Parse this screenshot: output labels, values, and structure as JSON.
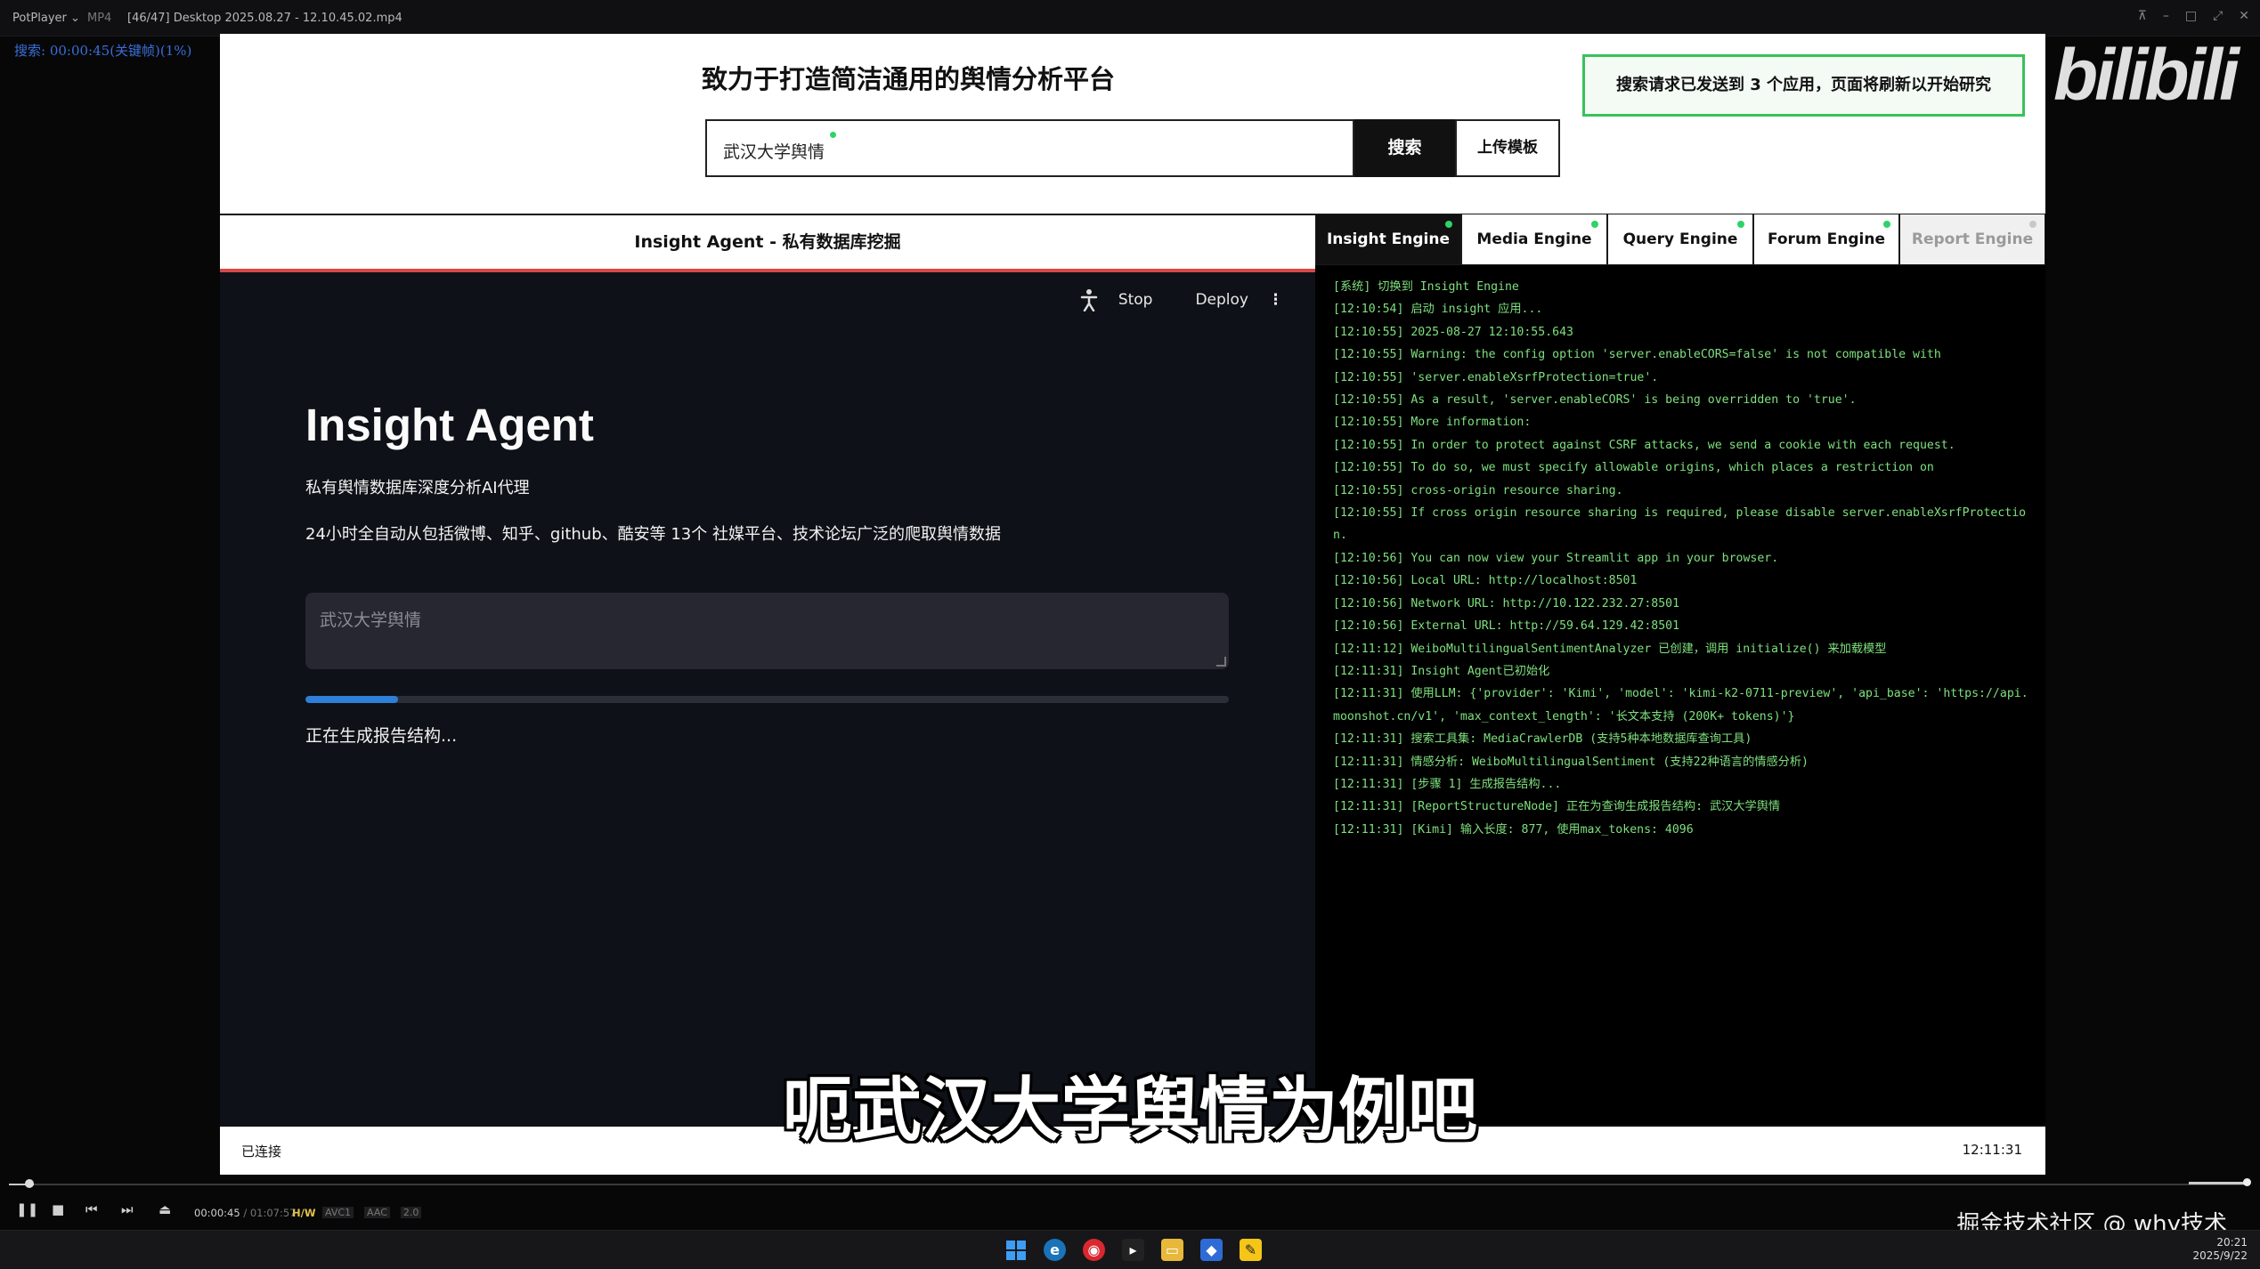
{
  "player": {
    "app_name": "PotPlayer ⌄",
    "format": "MP4",
    "file_title": "[46/47] Desktop 2025.08.27 - 12.10.45.02.mp4",
    "osd_text": "搜索: 00:00:45(关键帧)(1%)",
    "timecode": "00:00:45",
    "duration": "/ 01:07:57",
    "hw_label": "H/W",
    "codecs": [
      "AVC1",
      "AAC",
      "2.0"
    ],
    "progress": 0.011,
    "volume": 0.95
  },
  "app": {
    "title": "致力于打造简洁通用的舆情分析平台",
    "search_value": "武汉大学舆情",
    "search_button": "搜索",
    "upload_button": "上传模板",
    "toast": "搜索请求已发送到 3 个应用，页面将刷新以开始研究"
  },
  "left_panel": {
    "header": "Insight Agent - 私有数据库挖掘",
    "toolbar": {
      "stop": "Stop",
      "deploy": "Deploy"
    },
    "title": "Insight Agent",
    "subtitle": "私有舆情数据库深度分析AI代理",
    "description": "24小时全自动从包括微博、知乎、github、酷安等 13个 社媒平台、技术论坛广泛的爬取舆情数据",
    "textarea_placeholder": "武汉大学舆情",
    "progress": 0.1,
    "status": "正在生成报告结构..."
  },
  "tabs": [
    {
      "label": "Insight Engine",
      "state": "active"
    },
    {
      "label": "Media Engine",
      "state": "normal"
    },
    {
      "label": "Query Engine",
      "state": "normal"
    },
    {
      "label": "Forum Engine",
      "state": "normal"
    },
    {
      "label": "Report Engine",
      "state": "disabled"
    }
  ],
  "log_lines": [
    "[系统] 切换到 Insight Engine",
    "[12:10:54] 启动 insight 应用...",
    "[12:10:55] 2025-08-27 12:10:55.643",
    "[12:10:55] Warning: the config option 'server.enableCORS=false' is not compatible with",
    "[12:10:55] 'server.enableXsrfProtection=true'.",
    "[12:10:55] As a result, 'server.enableCORS' is being overridden to 'true'.",
    "[12:10:55] More information:",
    "[12:10:55] In order to protect against CSRF attacks, we send a cookie with each request.",
    "[12:10:55] To do so, we must specify allowable origins, which places a restriction on",
    "[12:10:55] cross-origin resource sharing.",
    "[12:10:55] If cross origin resource sharing is required, please disable server.enableXsrfProtection.",
    "[12:10:56] You can now view your Streamlit app in your browser.",
    "[12:10:56] Local URL: http://localhost:8501",
    "[12:10:56] Network URL: http://10.122.232.27:8501",
    "[12:10:56] External URL: http://59.64.129.42:8501",
    "[12:11:12] WeiboMultilingualSentimentAnalyzer 已创建，调用 initialize() 来加载模型",
    "[12:11:31] Insight Agent已初始化",
    "[12:11:31] 使用LLM: {'provider': 'Kimi', 'model': 'kimi-k2-0711-preview', 'api_base': 'https://api.moonshot.cn/v1', 'max_context_length': '长文本支持 (200K+ tokens)'}",
    "[12:11:31] 搜索工具集: MediaCrawlerDB (支持5种本地数据库查询工具)",
    "[12:11:31] 情感分析: WeiboMultilingualSentiment (支持22种语言的情感分析)",
    "[12:11:31] [步骤 1] 生成报告结构...",
    "[12:11:31] [ReportStructureNode] 正在为查询生成报告结构: 武汉大学舆情",
    "[12:11:31] [Kimi] 输入长度: 877, 使用max_tokens: 4096"
  ],
  "footer": {
    "status": "已连接",
    "time": "12:11:31"
  },
  "overlay": {
    "watermark": "bilibili",
    "subtitle": "呃武汉大学舆情为例吧",
    "credit": "掘金技术社区 @ why技术"
  },
  "tray": {
    "time": "20:21",
    "date": "2025/9/22"
  },
  "colors": {
    "accent_green": "#2ed36a",
    "log_green": "#7ee07e",
    "progress_blue": "#2d7fd8",
    "toast_border": "#38c25a"
  }
}
